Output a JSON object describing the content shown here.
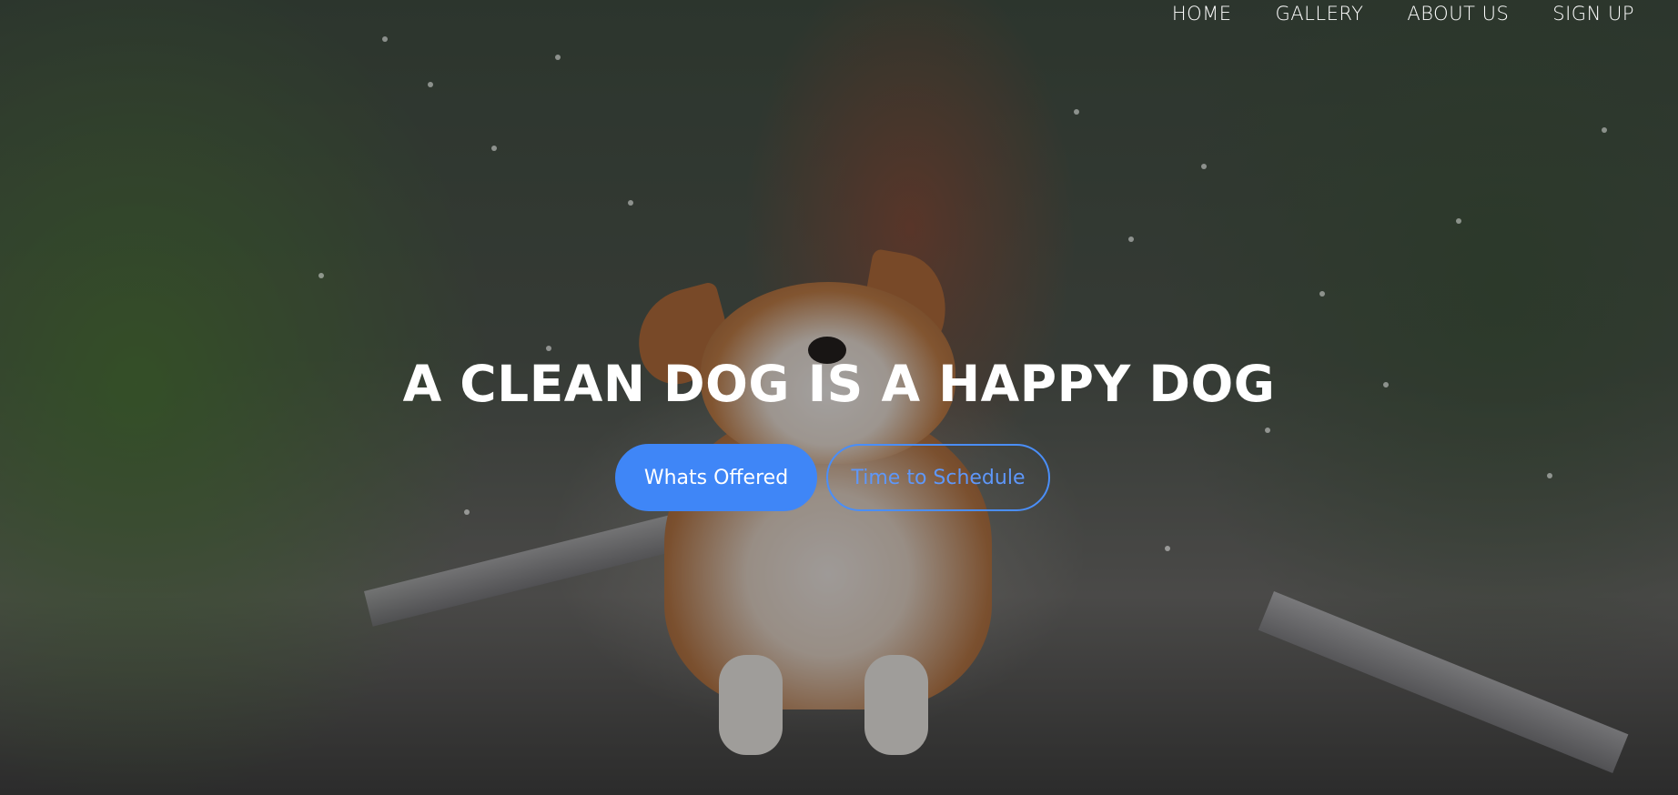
{
  "nav": {
    "items": [
      "HOME",
      "GALLERY",
      "ABOUT US",
      "SIGN UP"
    ]
  },
  "hero": {
    "headline": "A CLEAN DOG IS A HAPPY DOG",
    "primary_button": "Whats Offered",
    "secondary_button": "Time to Schedule"
  },
  "colors": {
    "accent": "#3f86f7",
    "text": "#ffffff"
  }
}
